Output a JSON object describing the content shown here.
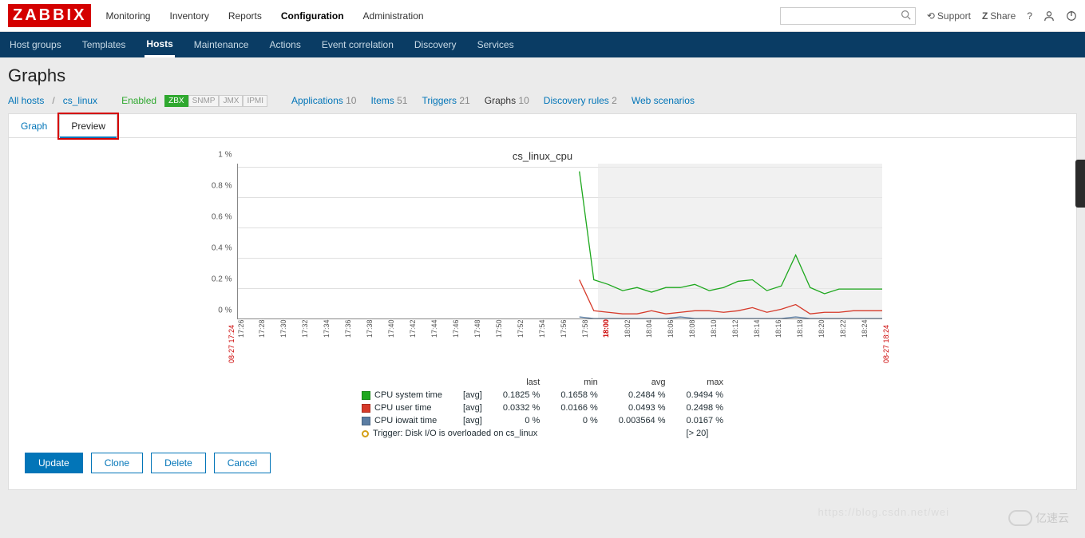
{
  "app": {
    "logo": "ZABBIX"
  },
  "top_menu": [
    "Monitoring",
    "Inventory",
    "Reports",
    "Configuration",
    "Administration"
  ],
  "top_menu_active": 3,
  "top_right": {
    "support": "Support",
    "share": "Share"
  },
  "sub_menu": [
    "Host groups",
    "Templates",
    "Hosts",
    "Maintenance",
    "Actions",
    "Event correlation",
    "Discovery",
    "Services"
  ],
  "sub_menu_active": 2,
  "page_title": "Graphs",
  "breadcrumb": {
    "all_hosts": "All hosts",
    "host": "cs_linux",
    "enabled": "Enabled",
    "badges": [
      "ZBX",
      "SNMP",
      "JMX",
      "IPMI"
    ]
  },
  "host_nav": [
    {
      "label": "Applications",
      "count": "10"
    },
    {
      "label": "Items",
      "count": "51"
    },
    {
      "label": "Triggers",
      "count": "21"
    },
    {
      "label": "Graphs",
      "count": "10",
      "current": true
    },
    {
      "label": "Discovery rules",
      "count": "2"
    },
    {
      "label": "Web scenarios",
      "count": ""
    }
  ],
  "tabs": [
    "Graph",
    "Preview"
  ],
  "tabs_active": 1,
  "chart": {
    "title": "cs_linux_cpu",
    "start_label": "08-27 17:24",
    "end_label": "08-27 18:24"
  },
  "chart_data": {
    "type": "line",
    "title": "cs_linux_cpu",
    "ylabel": "%",
    "ylim": [
      0,
      1.0
    ],
    "y_ticks": [
      "0 %",
      "0.2 %",
      "0.4 %",
      "0.6 %",
      "0.8 %",
      "1 %"
    ],
    "x_ticks": [
      "17:26",
      "17:28",
      "17:30",
      "17:32",
      "17:34",
      "17:36",
      "17:38",
      "17:40",
      "17:42",
      "17:44",
      "17:46",
      "17:48",
      "17:50",
      "17:52",
      "17:54",
      "17:56",
      "17:58",
      "18:00",
      "18:02",
      "18:04",
      "18:06",
      "18:08",
      "18:10",
      "18:12",
      "18:14",
      "18:16",
      "18:18",
      "18:20",
      "18:22",
      "18:24"
    ],
    "x_red_index": 17,
    "future_start_fraction": 0.56,
    "series": [
      {
        "name": "CPU system time",
        "color": "#1ea81e",
        "start_fraction": 0.53,
        "values": [
          0.95,
          0.25,
          0.22,
          0.18,
          0.2,
          0.17,
          0.2,
          0.2,
          0.22,
          0.18,
          0.2,
          0.24,
          0.25,
          0.18,
          0.21,
          0.41,
          0.2,
          0.16,
          0.19,
          0.19,
          0.19,
          0.19
        ]
      },
      {
        "name": "CPU user time",
        "color": "#d63a2a",
        "start_fraction": 0.53,
        "values": [
          0.25,
          0.05,
          0.04,
          0.03,
          0.03,
          0.05,
          0.03,
          0.04,
          0.05,
          0.05,
          0.04,
          0.05,
          0.07,
          0.04,
          0.06,
          0.09,
          0.03,
          0.04,
          0.04,
          0.05,
          0.05,
          0.05
        ]
      },
      {
        "name": "CPU iowait time",
        "color": "#5b7da3",
        "start_fraction": 0.53,
        "values": [
          0.01,
          0.0,
          0.0,
          0.0,
          0.0,
          0.0,
          0.0,
          0.01,
          0.0,
          0.0,
          0.0,
          0.0,
          0.0,
          0.0,
          0.0,
          0.01,
          0.0,
          0.0,
          0.0,
          0.0,
          0.0,
          0.0
        ]
      }
    ]
  },
  "legend": {
    "headers": [
      "",
      "",
      "last",
      "min",
      "avg",
      "max"
    ],
    "rows": [
      {
        "swatch": "#1ea81e",
        "name": "CPU system time",
        "agg": "[avg]",
        "last": "0.1825 %",
        "min": "0.1658 %",
        "avg": "0.2484 %",
        "max": "0.9494 %"
      },
      {
        "swatch": "#d63a2a",
        "name": "CPU user time",
        "agg": "[avg]",
        "last": "0.0332 %",
        "min": "0.0166 %",
        "avg": "0.0493 %",
        "max": "0.2498 %"
      },
      {
        "swatch": "#5b7da3",
        "name": "CPU iowait time",
        "agg": "[avg]",
        "last": "0 %",
        "min": "0 %",
        "avg": "0.003564 %",
        "max": "0.0167 %"
      }
    ],
    "trigger": {
      "text": "Trigger: Disk I/O is overloaded on cs_linux",
      "threshold": "[> 20]"
    }
  },
  "buttons": {
    "update": "Update",
    "clone": "Clone",
    "delete": "Delete",
    "cancel": "Cancel"
  },
  "watermark": {
    "brand": "亿速云",
    "url": "https://blog.csdn.net/wei"
  }
}
